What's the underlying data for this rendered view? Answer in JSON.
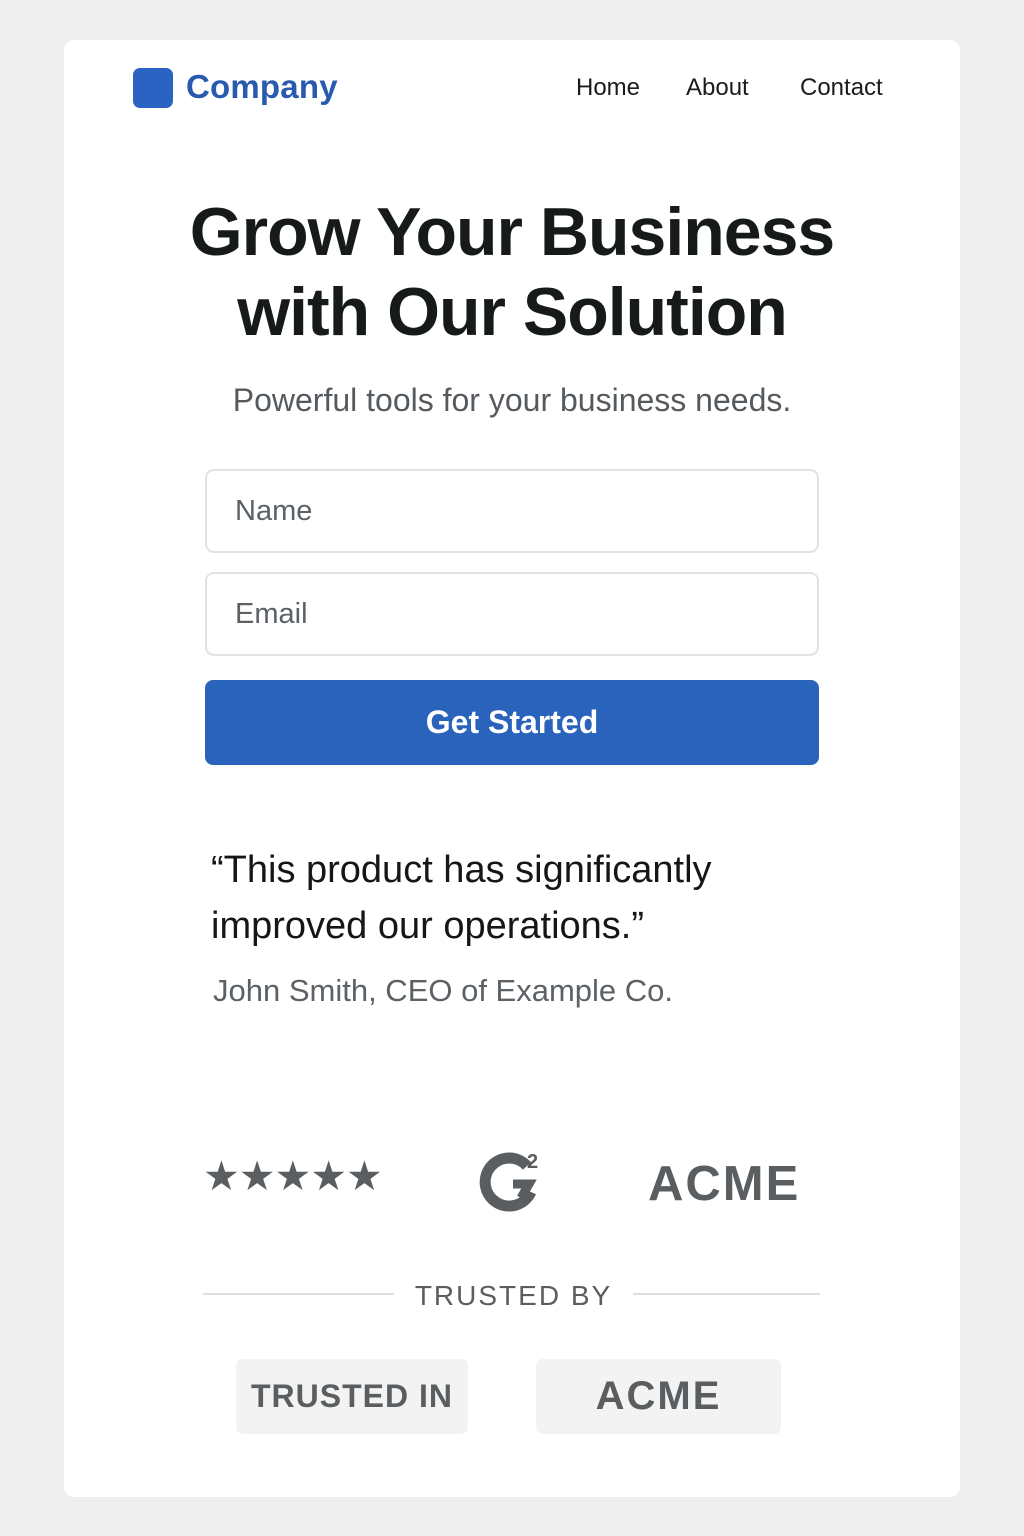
{
  "header": {
    "logo_text": "Company",
    "nav": [
      "Home",
      "About",
      "Contact"
    ]
  },
  "hero": {
    "headline_line1": "Grow Your Business",
    "headline_line2": "with Our Solution",
    "subheadline": "Powerful tools for your business needs."
  },
  "form": {
    "name_placeholder": "Name",
    "email_placeholder": "Email",
    "submit_label": "Get Started"
  },
  "testimonial": {
    "quote": "“This product has significantly improved our operations.”",
    "author": "John Smith, CEO of Example Co."
  },
  "badges": {
    "stars": "★★★★★",
    "rating_stars": 5,
    "g2_superscript": "2",
    "acme_logo": "ACME"
  },
  "trust": {
    "divider_label": "TRUSTED BY",
    "badge_trusted_in": "TRUSTED IN",
    "badge_acme": "ACME"
  },
  "colors": {
    "accent": "#2a63bb",
    "logo": "#2a5aad",
    "muted_gray": "#5a5e61",
    "background": "#efefef"
  },
  "icons": {
    "logo_mark": "rounded-square-logo-icon",
    "g2": "g2-logo-icon",
    "star": "star-icon"
  }
}
